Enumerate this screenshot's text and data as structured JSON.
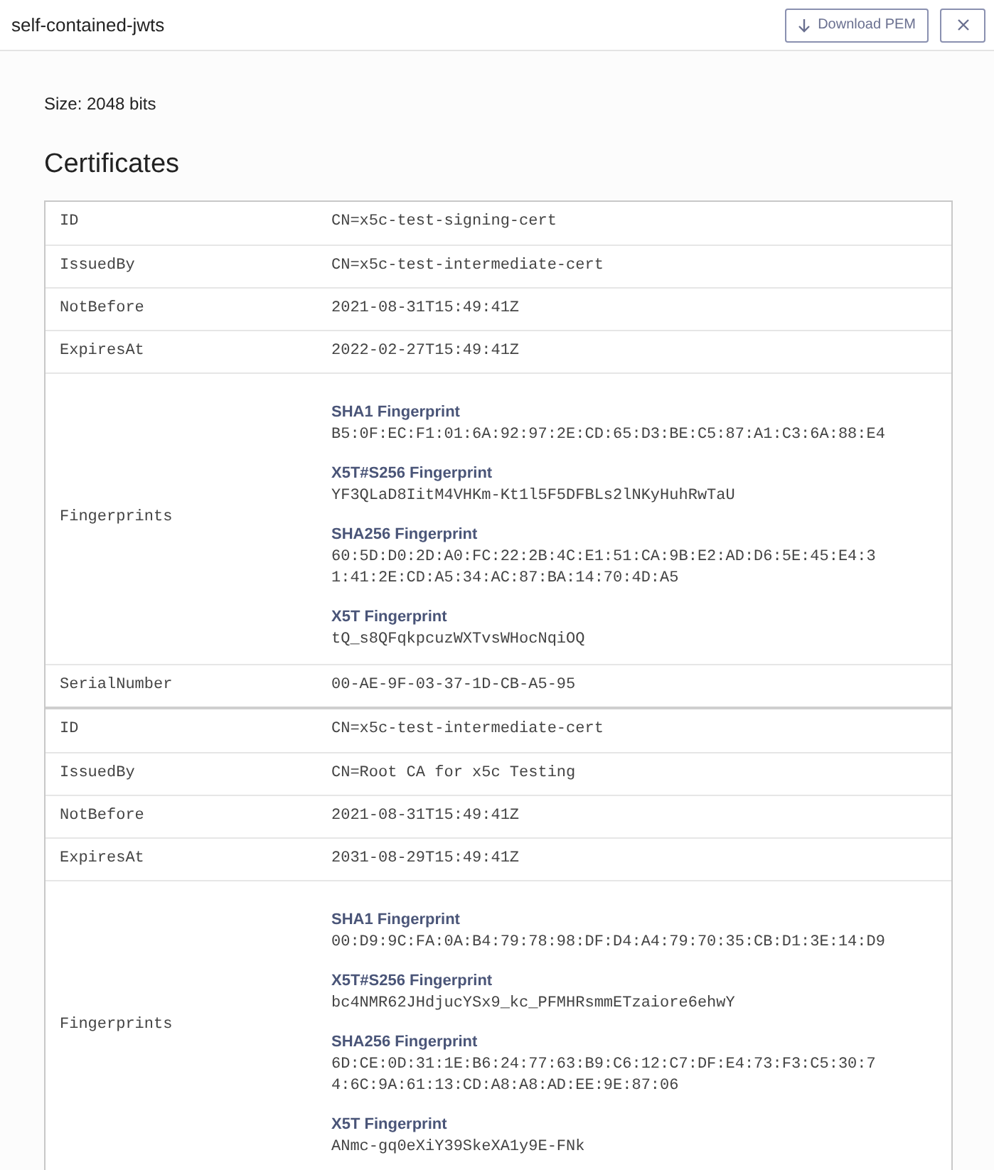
{
  "header": {
    "title": "self-contained-jwts",
    "download_button": "Download PEM"
  },
  "size": "Size: 2048 bits",
  "section_title": "Certificates",
  "certificates": [
    {
      "rows": [
        {
          "kind": "text",
          "label": "ID",
          "value": "CN=x5c-test-signing-cert"
        },
        {
          "kind": "text",
          "label": "IssuedBy",
          "value": "CN=x5c-test-intermediate-cert"
        },
        {
          "kind": "text",
          "label": "NotBefore",
          "value": "2021-08-31T15:49:41Z"
        },
        {
          "kind": "text",
          "label": "ExpiresAt",
          "value": "2022-02-27T15:49:41Z"
        },
        {
          "kind": "fingerprints",
          "label": "Fingerprints",
          "items": [
            {
              "name": "SHA1 Fingerprint",
              "value": "B5:0F:EC:F1:01:6A:92:97:2E:CD:65:D3:BE:C5:87:A1:C3:6A:88:E4"
            },
            {
              "name": "X5T#S256 Fingerprint",
              "value": "YF3QLaD8IitM4VHKm-Kt1l5F5DFBLs2lNKyHuhRwTaU"
            },
            {
              "name": "SHA256 Fingerprint",
              "value": "60:5D:D0:2D:A0:FC:22:2B:4C:E1:51:CA:9B:E2:AD:D6:5E:45:E4:31:41:2E:CD:A5:34:AC:87:BA:14:70:4D:A5"
            },
            {
              "name": "X5T Fingerprint",
              "value": "tQ_s8QFqkpcuzWXTvsWHocNqiOQ"
            }
          ]
        },
        {
          "kind": "text",
          "label": "SerialNumber",
          "value": "00-AE-9F-03-37-1D-CB-A5-95"
        }
      ]
    },
    {
      "rows": [
        {
          "kind": "text",
          "label": "ID",
          "value": "CN=x5c-test-intermediate-cert"
        },
        {
          "kind": "text",
          "label": "IssuedBy",
          "value": "CN=Root CA for x5c Testing"
        },
        {
          "kind": "text",
          "label": "NotBefore",
          "value": "2021-08-31T15:49:41Z"
        },
        {
          "kind": "text",
          "label": "ExpiresAt",
          "value": "2031-08-29T15:49:41Z"
        },
        {
          "kind": "fingerprints",
          "label": "Fingerprints",
          "items": [
            {
              "name": "SHA1 Fingerprint",
              "value": "00:D9:9C:FA:0A:B4:79:78:98:DF:D4:A4:79:70:35:CB:D1:3E:14:D9"
            },
            {
              "name": "X5T#S256 Fingerprint",
              "value": "bc4NMR62JHdjucYSx9_kc_PFMHRsmmETzaiore6ehwY"
            },
            {
              "name": "SHA256 Fingerprint",
              "value": "6D:CE:0D:31:1E:B6:24:77:63:B9:C6:12:C7:DF:E4:73:F3:C5:30:74:6C:9A:61:13:CD:A8:A8:AD:EE:9E:87:06"
            },
            {
              "name": "X5T Fingerprint",
              "value": "ANmc-gq0eXiY39SkeXA1y9E-FNk"
            }
          ]
        }
      ]
    }
  ]
}
